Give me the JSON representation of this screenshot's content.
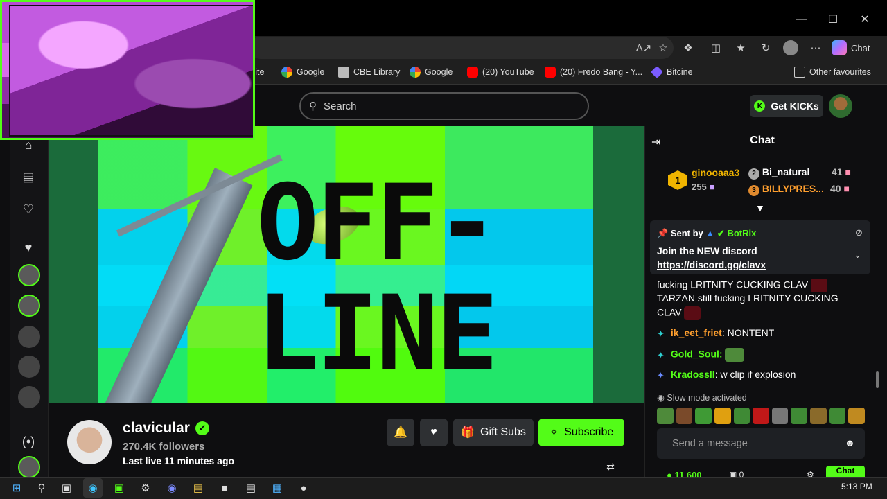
{
  "browser": {
    "favorites": [
      {
        "label": "site",
        "icon": "page-icon"
      },
      {
        "label": "Google",
        "icon": "google-icon"
      },
      {
        "label": "CBE Library",
        "icon": "library-icon"
      },
      {
        "label": "Google",
        "icon": "google-icon"
      },
      {
        "label": "(20) YouTube",
        "icon": "youtube-icon"
      },
      {
        "label": "(20) Fredo Bang - Y...",
        "icon": "youtube-icon"
      },
      {
        "label": "Bitcine",
        "icon": "bitcine-icon"
      }
    ],
    "other_favourites": "Other favourites",
    "copilot_label": "Chat"
  },
  "header": {
    "search_placeholder": "Search",
    "get_kicks_label": "Get KICKs"
  },
  "player": {
    "offline_line1": "OFF-",
    "offline_line2": "LINE"
  },
  "channel": {
    "name": "clavicular",
    "followers": "270.4K followers",
    "last_live": "Last live 11 minutes ago",
    "gift_subs_label": "Gift Subs",
    "subscribe_label": "Subscribe"
  },
  "chat": {
    "title": "Chat",
    "leaderboard": [
      {
        "rank": "1",
        "name": "ginooaaa3",
        "amount": "255"
      },
      {
        "rank": "2",
        "name": "Bi_natural",
        "amount": "41"
      },
      {
        "rank": "3",
        "name": "BILLYPRES...",
        "amount": "40"
      }
    ],
    "pinned": {
      "sent_by": "Sent by",
      "author": "BotRix",
      "line1": "Join the NEW discord",
      "link": "https://discord.gg/clavx"
    },
    "messages": [
      {
        "text": "fucking LRITNITY CUCKING CLAV"
      },
      {
        "text": "TARZAN still fucking LRITNITY CUCKING"
      },
      {
        "text": "CLAV"
      },
      {
        "user": "ik_eet_friet",
        "text": ": NONTENT"
      },
      {
        "user": "Gold_Soul:",
        "text": ""
      },
      {
        "user": "Kradossll",
        "text": ": w clip if explosion"
      }
    ],
    "slow_mode": "Slow mode activated",
    "input_placeholder": "Send a message",
    "viewer_count": "11,600",
    "chat_button": "Chat"
  },
  "taskbar": {
    "time": "5:13 PM"
  },
  "colors": {
    "kick_green": "#53fc18",
    "bg": "#0e0e10",
    "username_orange": "#ff9f2e"
  }
}
